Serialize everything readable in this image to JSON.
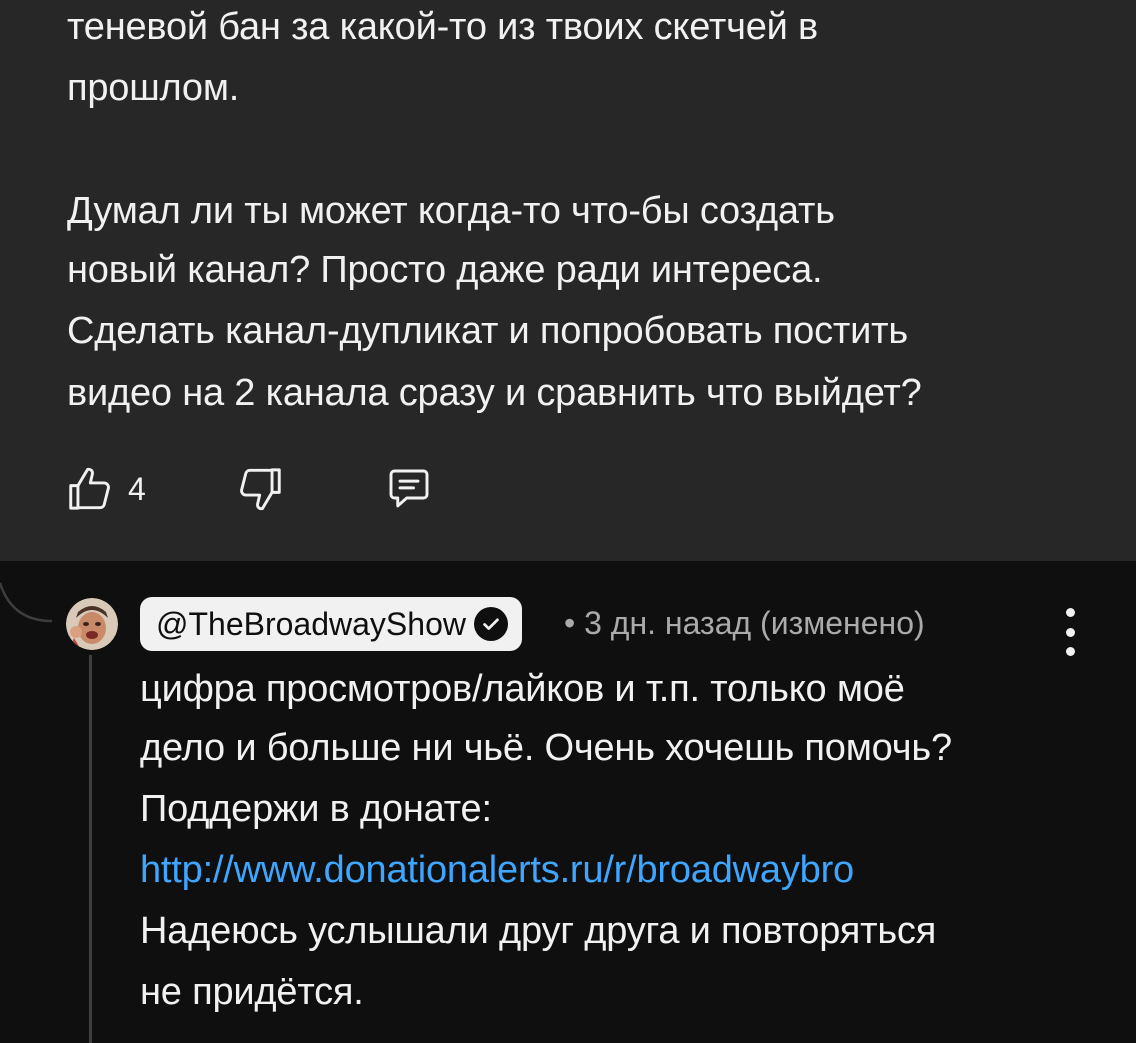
{
  "parent_comment": {
    "lines": [
      "теневой бан за какой-то из твоих скетчей в",
      "прошлом.",
      "Думал ли ты может когда-то что-бы создать",
      "новый канал? Просто даже ради интереса.",
      "Сделать канал-дупликат и попробовать постить",
      "видео на 2 канала сразу и сравнить что выйдет?"
    ],
    "like_count": "4"
  },
  "reply": {
    "author": "@TheBroadwayShow",
    "meta": "• 3 дн. назад (изменено)",
    "lines": [
      "цифра просмотров/лайков и т.п. только моё",
      "дело и больше ни чьё. Очень хочешь помочь?",
      "Поддержи в донате:",
      "http://www.donationalerts.ru/r/broadwaybro",
      "Надеюсь услышали друг друга и повторяться",
      "не придётся."
    ]
  },
  "colors": {
    "background": "#0f0f0f",
    "highlight": "#272727",
    "text": "#f1f1f1",
    "secondary_text": "#aaaaaa",
    "link": "#3ea6ff",
    "chip": "#f1f1f1"
  },
  "icons": [
    "thumb-up-icon",
    "thumb-down-icon",
    "reply-icon",
    "verified-check-icon",
    "more-vert-icon"
  ]
}
